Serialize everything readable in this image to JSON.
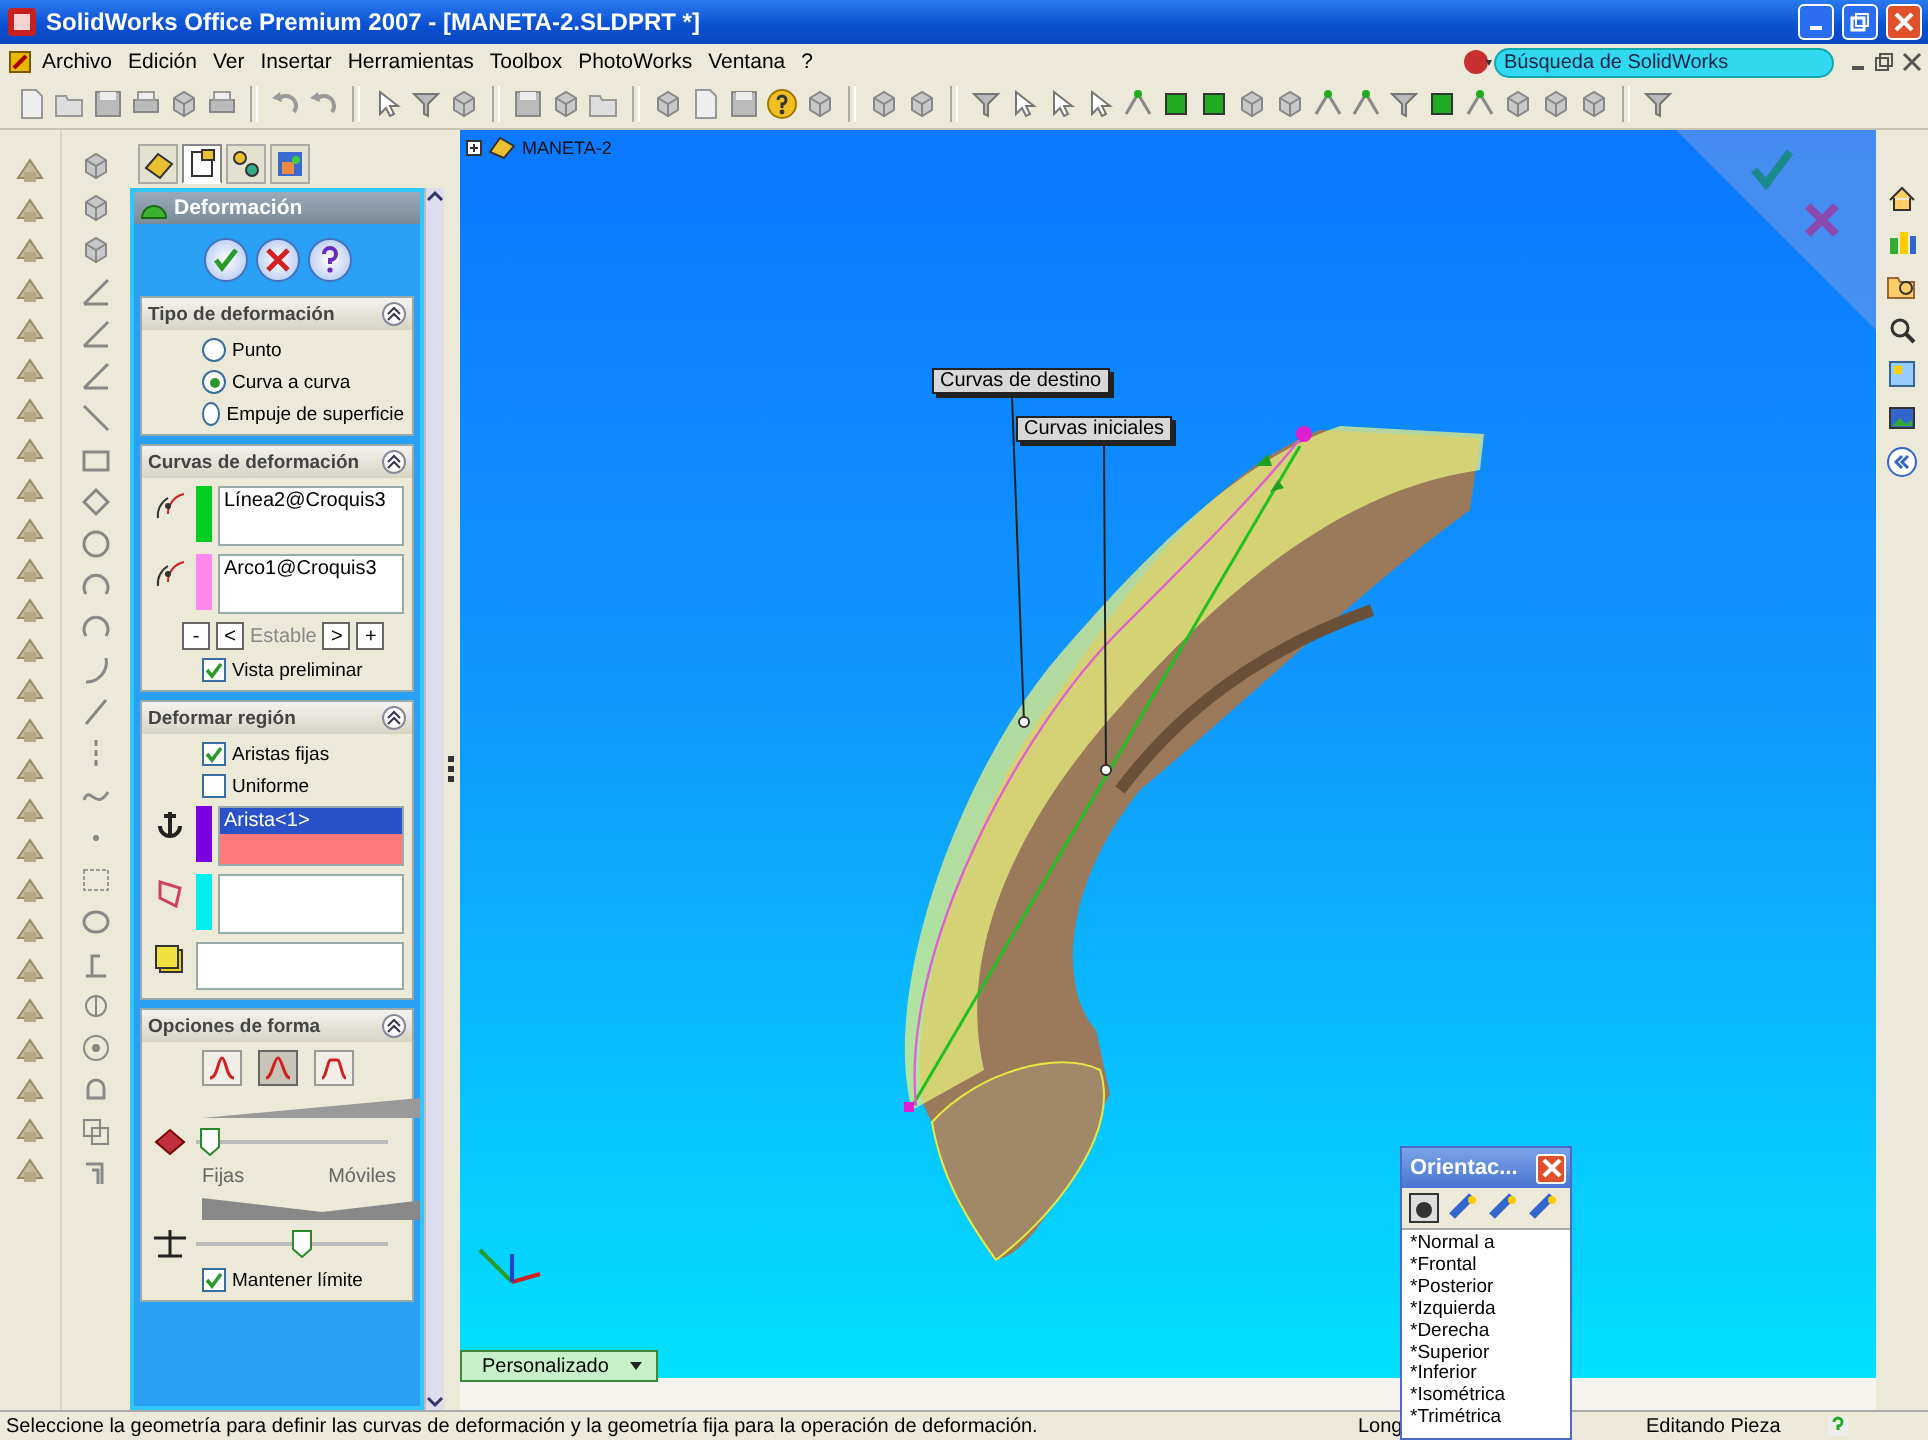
{
  "window": {
    "title": "SolidWorks Office Premium 2007 - [MANETA-2.SLDPRT *]"
  },
  "menu": [
    "Archivo",
    "Edición",
    "Ver",
    "Insertar",
    "Herramientas",
    "Toolbox",
    "PhotoWorks",
    "Ventana",
    "?"
  ],
  "search": {
    "placeholder": "Búsqueda de SolidWorks"
  },
  "manager_tabs": [
    {
      "selected": false
    },
    {
      "selected": true
    },
    {
      "selected": false
    },
    {
      "selected": false
    }
  ],
  "property_manager": {
    "title": "Deformación",
    "sections": [
      {
        "kind": "radios",
        "title": "Tipo de deformación",
        "options": [
          {
            "label": "Punto",
            "selected": false
          },
          {
            "label": "Curva a curva",
            "selected": true
          },
          {
            "label": "Empuje de superficie",
            "selected": false
          }
        ]
      },
      {
        "kind": "curves",
        "title": "Curvas de deformación",
        "lists": [
          {
            "items": [
              {
                "text": "Línea2@Croquis3",
                "selected": false
              }
            ],
            "color": "#00cc22",
            "active": false
          },
          {
            "items": [
              {
                "text": "Arco1@Croquis3",
                "selected": false
              }
            ],
            "color": "#ff88ee",
            "active": false
          }
        ],
        "stepper": [
          "-",
          "<",
          "Estable",
          ">",
          "+"
        ],
        "checkboxes": [
          {
            "label": "Vista preliminar",
            "checked": true
          }
        ]
      },
      {
        "kind": "region",
        "title": "Deformar región",
        "checkboxes": [
          {
            "label": "Aristas fijas",
            "checked": true
          },
          {
            "label": "Uniforme",
            "checked": false
          }
        ],
        "lists": [
          {
            "items": [
              {
                "text": "Arista<1>",
                "selected": true
              }
            ],
            "color": "#7a00e0",
            "active": true
          },
          {
            "color": "#00eeee",
            "active": false
          },
          {
            "active": false
          }
        ]
      },
      {
        "kind": "shape",
        "title": "Opciones de forma",
        "shape_buttons": [
          {
            "selected": false
          },
          {
            "selected": true
          },
          {
            "selected": false
          }
        ],
        "sliders": [
          {
            "level": 0.02
          },
          {
            "level": 0.5
          }
        ],
        "slider_labels": [
          "Fijas",
          "Móviles"
        ],
        "checkboxes": [
          {
            "label": "Mantener límite",
            "checked": true
          }
        ]
      }
    ]
  },
  "viewport": {
    "tree_root": "MANETA-2",
    "callouts": [
      "Curvas de destino",
      "Curvas iniciales"
    ],
    "view_tab": "Personalizado"
  },
  "orientation": {
    "title": "Orientac...",
    "views": [
      "*Normal a",
      "*Frontal",
      "*Posterior",
      "*Izquierda",
      "*Derecha",
      "*Superior",
      "*Inferior",
      "*Isométrica",
      "*Trimétrica"
    ]
  },
  "status_bar": {
    "message": "Seleccione la geometría para definir las curvas de deformación y la geometría fija para la operación de deformación.",
    "fields": [
      "Long",
      "Editando Pieza"
    ]
  }
}
